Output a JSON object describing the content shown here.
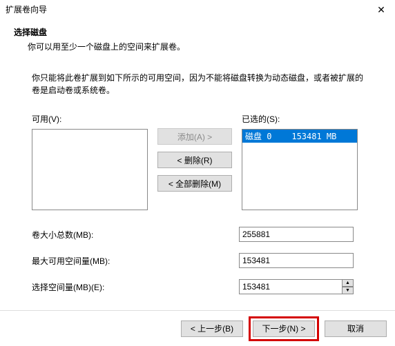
{
  "titlebar": {
    "title": "扩展卷向导",
    "close": "✕"
  },
  "header": {
    "heading": "选择磁盘",
    "subheading": "你可以用至少一个磁盘上的空间来扩展卷。"
  },
  "description": "你只能将此卷扩展到如下所示的可用空间，因为不能将磁盘转换为动态磁盘，或者被扩展的卷是启动卷或系统卷。",
  "labels": {
    "available": "可用(V):",
    "selected": "已选的(S):"
  },
  "available_list": [],
  "selected_list": [
    {
      "text": "磁盘 0    153481 MB",
      "selected": true
    }
  ],
  "buttons": {
    "add": "添加(A) >",
    "remove": "< 删除(R)",
    "remove_all": "< 全部删除(M)"
  },
  "fields": {
    "total_size_label": "卷大小总数(MB):",
    "total_size_value": "255881",
    "max_space_label": "最大可用空间量(MB):",
    "max_space_value": "153481",
    "select_space_label": "选择空间量(MB)(E):",
    "select_space_value": "153481"
  },
  "spin": {
    "up": "▲",
    "down": "▼"
  },
  "footer": {
    "back": "< 上一步(B)",
    "next": "下一步(N) >",
    "cancel": "取消"
  }
}
